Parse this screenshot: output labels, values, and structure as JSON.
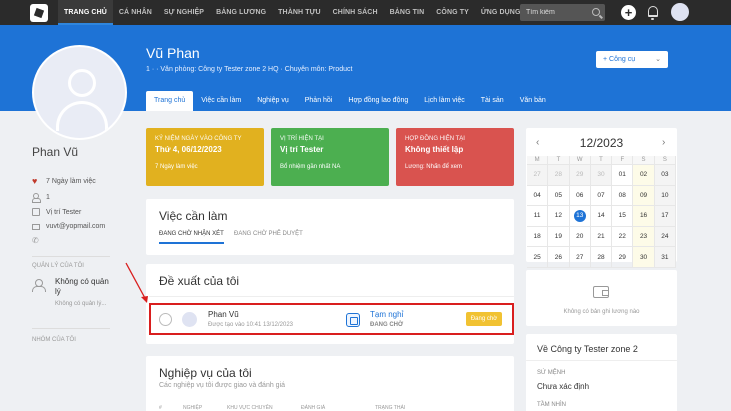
{
  "nav": {
    "items": [
      "TRANG CHỦ",
      "CÁ NHÂN",
      "SỰ NGHIỆP",
      "BẢNG LƯƠNG",
      "THÀNH TỰU",
      "CHÍNH SÁCH",
      "BẢNG TIN",
      "CÔNG TY",
      "ỨNG DỤNG"
    ],
    "search_placeholder": "Tìm kiếm"
  },
  "header": {
    "name": "Vũ Phan",
    "subtitle": "1 · · Văn phòng: Công ty Tester zone 2 HQ · Chuyên môn: Product",
    "action_button": "+ Công cụ",
    "tabs": [
      "Trang chủ",
      "Việc cần làm",
      "Nghiệp vụ",
      "Phản hồi",
      "Hợp đồng lao động",
      "Lịch làm việc",
      "Tài sản",
      "Văn bản"
    ]
  },
  "profile": {
    "full_name": "Phan Vũ",
    "work_days": "7 Ngày làm việc",
    "reports": "1",
    "position": "Vị trí Tester",
    "email": "vuvt@yopmail.com",
    "manager_label": "QUẢN LÝ CỦA TÔI",
    "manager_name": "Không có quản lý",
    "manager_sub": "Không có quản lý...",
    "group_label": "NHÓM CỦA TÔI"
  },
  "stats": [
    {
      "label": "KỶ NIỆM NGÀY VÀO CÔNG TY",
      "value": "Thứ 4, 06/12/2023",
      "sub": "7 Ngày làm việc",
      "color": "#e1b11f"
    },
    {
      "label": "VỊ TRÍ HIỆN TẠI",
      "value": "Vị trí Tester",
      "sub": "Bổ nhiệm gần nhất NA",
      "color": "#4caf50"
    },
    {
      "label": "HỢP ĐỒNG HIỆN TẠI",
      "value": "Không thiết lập",
      "sub": "Lương: Nhấn để xem",
      "color": "#d9534f"
    }
  ],
  "todo": {
    "title": "Việc cần làm",
    "tabs": [
      "ĐANG CHỜ NHẬN XÉT",
      "ĐANG CHỜ PHÊ DUYỆT"
    ]
  },
  "proposals": {
    "title": "Đề xuất của tôi",
    "row": {
      "name": "Phan Vũ",
      "meta": "Được tạo vào 10:41 13/12/2023",
      "type": "Tạm nghỉ",
      "state": "ĐANG CHỜ",
      "badge": "Đang chờ",
      "badge_color": "#f1c232"
    }
  },
  "business": {
    "title": "Nghiệp vụ của tôi",
    "subtitle": "Các nghiệp vụ tôi được giao và đánh giá",
    "columns": [
      "#",
      "NGHIỆP",
      "KHU VỰC CHUYÊN",
      "ĐÁNH GIÁ",
      "TRẠNG THÁI"
    ]
  },
  "calendar": {
    "title": "12/2023",
    "prev": "‹",
    "next": "›",
    "weekdays": [
      "M",
      "T",
      "W",
      "T",
      "F",
      "S",
      "S"
    ],
    "weeks": [
      [
        "27",
        "28",
        "29",
        "30",
        "01",
        "02",
        "03"
      ],
      [
        "04",
        "05",
        "06",
        "07",
        "08",
        "09",
        "10"
      ],
      [
        "11",
        "12",
        "13",
        "14",
        "15",
        "16",
        "17"
      ],
      [
        "18",
        "19",
        "20",
        "21",
        "22",
        "23",
        "24"
      ],
      [
        "25",
        "26",
        "27",
        "28",
        "29",
        "30",
        "31"
      ]
    ],
    "today": "13"
  },
  "salary_empty": "Không có bản ghi lương nào",
  "about": {
    "title": "Về Công ty Tester zone 2",
    "mission_label": "SỨ MỆNH",
    "mission_value": "Chưa xác định",
    "vision_label": "TẦM NHÌN"
  }
}
